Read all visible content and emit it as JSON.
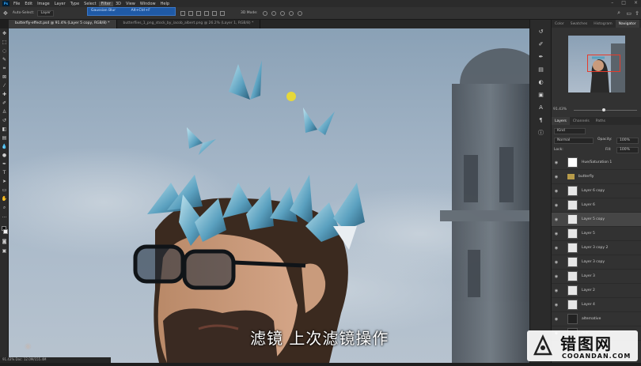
{
  "menu": {
    "logo": "Ps",
    "items": [
      "File",
      "Edit",
      "Image",
      "Layer",
      "Type",
      "Select",
      "Filter",
      "3D",
      "View",
      "Window",
      "Help"
    ],
    "highlighted": "Filter"
  },
  "options": {
    "auto_select_label": "Auto-Select:",
    "auto_select_value": "Layer",
    "tooltip_title": "Gaussian Blur",
    "tooltip_shortcut": "Alt+Ctrl+F",
    "mode3d_label": "3D Mode:"
  },
  "tabs": [
    {
      "label": "butterfly-effect.psd @ 91.4% (Layer 5 copy, RGB/8) *",
      "active": true
    },
    {
      "label": "butterflies_1_png_stock_by_iacob_albert.png @ 26.2% (Layer 1, RGB/8) *",
      "active": false
    }
  ],
  "canvas": {
    "subtitle": "滤镜 上次滤镜操作",
    "zoom_status": "91.43%    Doc: 12.0M/155.4M"
  },
  "panels": {
    "top_tabs": [
      "Color",
      "Swatches",
      "Histogram",
      "Navigator"
    ],
    "active_top_tab": "Navigator",
    "nav_zoom": "91.43%",
    "layer_tabs": [
      "Layers",
      "Channels",
      "Paths"
    ],
    "active_layer_tab": "Layers",
    "kind_filter": "Kind",
    "blend_mode": "Normal",
    "opacity_label": "Opacity:",
    "opacity_value": "100%",
    "lock_label": "Lock:",
    "fill_label": "Fill:",
    "fill_value": "100%",
    "layers": [
      {
        "name": "Hue/Saturation 1",
        "type": "mask"
      },
      {
        "name": "butterfly",
        "type": "group"
      },
      {
        "name": "Layer 6 copy",
        "type": "normal"
      },
      {
        "name": "Layer 6",
        "type": "normal"
      },
      {
        "name": "Layer 5 copy",
        "type": "normal",
        "selected": true
      },
      {
        "name": "Layer 5",
        "type": "normal"
      },
      {
        "name": "Layer 3 copy 2",
        "type": "normal"
      },
      {
        "name": "Layer 3 copy",
        "type": "normal"
      },
      {
        "name": "Layer 3",
        "type": "normal"
      },
      {
        "name": "Layer 2",
        "type": "normal"
      },
      {
        "name": "Layer 4",
        "type": "normal"
      },
      {
        "name": "alternative",
        "type": "dark"
      },
      {
        "name": "man",
        "type": "dark"
      }
    ]
  },
  "watermark": {
    "brand": "错图网",
    "url": "COOANDAN.COM"
  },
  "colors": {
    "accent": "#31a8ff",
    "selection_rect": "#e53b2b",
    "panel_bg": "#323232",
    "sky_top": "#8aa1b6",
    "sky_bottom": "#b7c3cf"
  }
}
